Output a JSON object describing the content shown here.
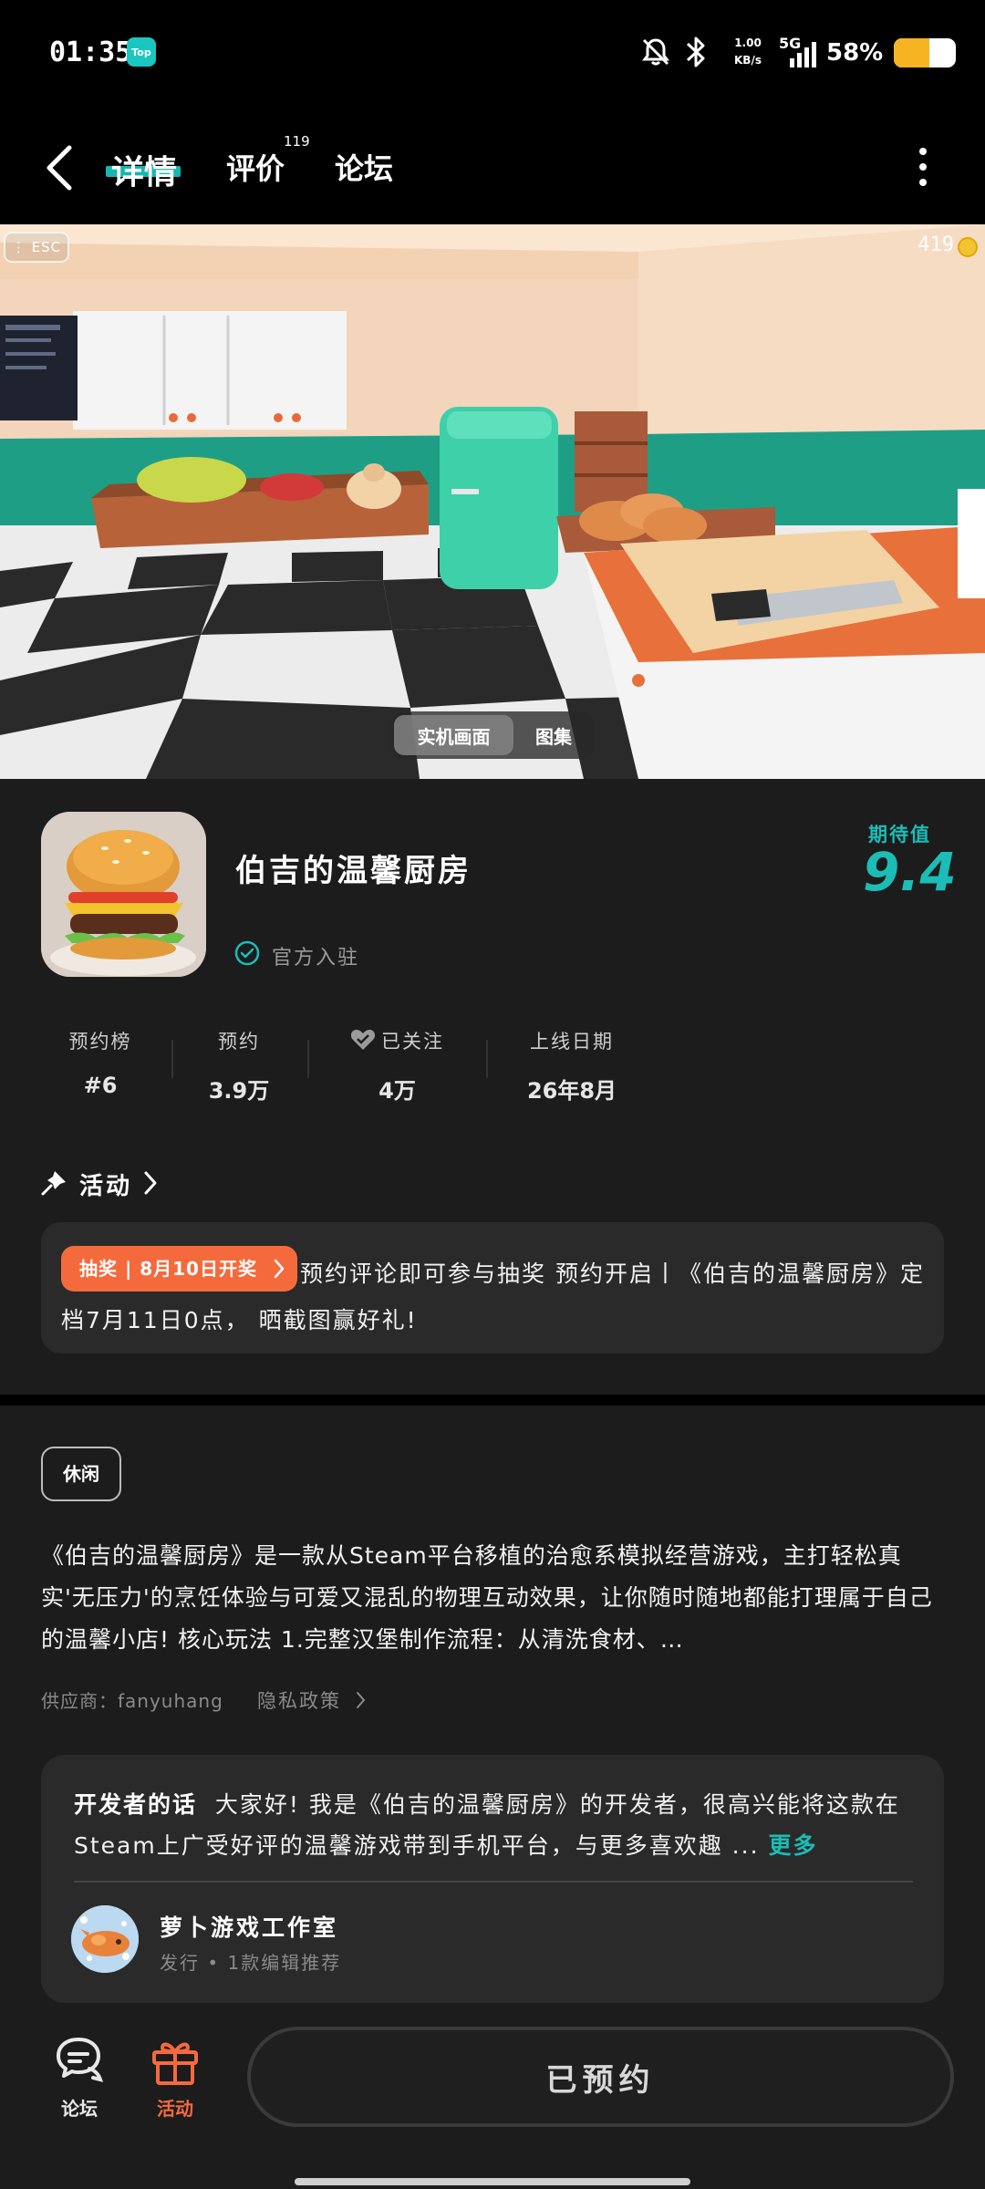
{
  "status_bar": {
    "time": "01:35",
    "app_badge": "Top",
    "net_speed_value": "1.00",
    "net_speed_unit": "KB/s",
    "network": "5G",
    "battery_percent": "58%",
    "battery_level": 0.58,
    "battery_color": "#f6b322"
  },
  "header": {
    "tabs": [
      {
        "label": "详情",
        "active": true
      },
      {
        "label": "评价",
        "count": "119"
      },
      {
        "label": "论坛"
      }
    ],
    "accent": "#19b6b0"
  },
  "hero": {
    "esc_label": "ESC",
    "coin_count": "419",
    "media_options": [
      "实机画面",
      "图集"
    ],
    "active_media": "实机画面"
  },
  "game": {
    "title": "伯吉的温馨厨房",
    "verified_label": "官方入驻",
    "expect_label": "期待值",
    "expect_score": "9.4"
  },
  "stats": [
    {
      "label": "预约榜",
      "value": "#6"
    },
    {
      "label": "预约",
      "value": "3.9万"
    },
    {
      "label": "已关注",
      "value": "4万"
    },
    {
      "label": "上线日期",
      "value": "26年8月"
    }
  ],
  "activity": {
    "section_title": "活动",
    "badge": "抽奖 | 8月10日开奖",
    "text": "预约评论即可参与抽奖 预约开启丨《伯吉的温馨厨房》定档7月11日0点， 晒截图赢好礼!"
  },
  "description": {
    "tag": "休闲",
    "text": "《伯吉的温馨厨房》是一款从Steam平台移植的治愈系模拟经营游戏，主打轻松真实'无压力'的烹饪体验与可爱又混乱的物理互动效果，让你随时随地都能打理属于自己的温馨小店! 核心玩法 1.完整汉堡制作流程：从清洗食材、…",
    "supplier": "供应商：fanyuhang",
    "privacy": "隐私政策"
  },
  "developer": {
    "heading": "开发者的话",
    "text": "大家好! 我是《伯吉的温馨厨房》的开发者，很高兴能将这款在Steam上广受好评的温馨游戏带到手机平台，与更多喜欢趣 ...",
    "more": "更多",
    "studio_name": "萝卜游戏工作室",
    "studio_sub": "发行 • 1款编辑推荐"
  },
  "bottom_bar": {
    "forum_label": "论坛",
    "activity_label": "活动",
    "reserve_label": "已预约",
    "activity_color": "#f56a3d"
  }
}
